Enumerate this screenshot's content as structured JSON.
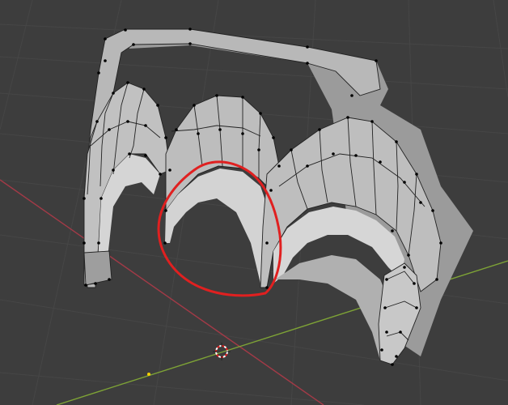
{
  "viewport": {
    "background": "#3d3d3d",
    "grid_color": "#464646",
    "x_axis_color": "#a33a47",
    "y_axis_color": "#7ea336",
    "mesh_face": "#a7a7a7",
    "mesh_face_light": "#c4c4c4",
    "mesh_face_dark": "#8a8a8a",
    "annotation_color": "#e02020"
  },
  "mesh": {
    "name_icon": "mesh-object",
    "mode": "edit-mode-vertex-select"
  },
  "cursor": {
    "icon": "3d-cursor-icon"
  },
  "origin": {
    "icon": "object-origin-dot"
  }
}
